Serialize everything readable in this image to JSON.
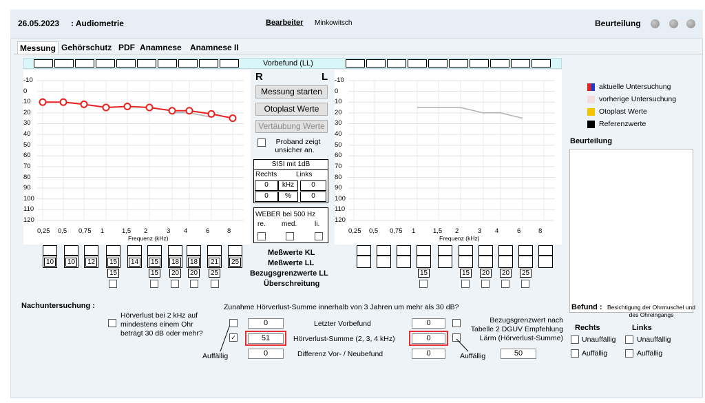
{
  "header": {
    "date": "26.05.2023",
    "title": ": Audiometrie",
    "bearbeiter_label": "Bearbeiter",
    "bearbeiter_value": "Minkowitsch",
    "beurteilung_label": "Beurteilung"
  },
  "tabs": [
    "Messung",
    "Gehörschutz",
    "PDF",
    "Anamnese",
    "Anamnese II"
  ],
  "vorbefund_label": "Vorbefund (LL)",
  "y_ticks": [
    "-10",
    "0",
    "10",
    "20",
    "30",
    "40",
    "50",
    "60",
    "70",
    "80",
    "90",
    "100",
    "110",
    "120"
  ],
  "x_ticks": [
    "0,25",
    "0,5",
    "0,75",
    "1",
    "1,5",
    "2",
    "3",
    "4",
    "6",
    "8"
  ],
  "x_axis_label": "Frequenz (kHz)",
  "right_label": "R",
  "left_label": "L",
  "buttons": {
    "start": "Messung starten",
    "otoplast": "Otoplast Werte",
    "vertaeubung": "Vertäubung Werte"
  },
  "proband": "Proband zeigt unsicher an.",
  "sisi": {
    "title": "SISI mit 1dB",
    "rechts": "Rechts",
    "links": "Links",
    "r1": "0",
    "unit1": "kHz",
    "l1": "0",
    "r2": "0",
    "unit2": "%",
    "l2": "0"
  },
  "weber": {
    "title": "WEBER bei 500 Hz",
    "re": "re.",
    "med": "med.",
    "li": "li."
  },
  "row_labels": {
    "kl": "Meßwerte KL",
    "ll": "Meßwerte LL",
    "bezug": "Bezugsgrenzwerte LL",
    "ueber": "Überschreitung"
  },
  "right_ll_values": [
    "10",
    "10",
    "12",
    "15",
    "14",
    "15",
    "18",
    "18",
    "21",
    "25"
  ],
  "right_bezug": [
    "15",
    "",
    "",
    "15",
    "20",
    "20",
    "25"
  ],
  "left_bezug": [
    "15",
    "",
    "15",
    "20",
    "20",
    "25"
  ],
  "chart_data": [
    {
      "type": "line",
      "title": "",
      "xlabel": "Frequenz (kHz)",
      "ylabel": "",
      "categories": [
        "0,25",
        "0,5",
        "0,75",
        "1",
        "1,5",
        "2",
        "3",
        "4",
        "6",
        "8"
      ],
      "ylim": [
        -10,
        120
      ],
      "y_inverted": true,
      "series": [
        {
          "values": [
            10,
            10,
            12,
            15,
            14,
            15,
            18,
            18,
            21,
            25
          ],
          "color": "#e8211e",
          "markers": "circle"
        },
        {
          "values": [
            null,
            null,
            null,
            null,
            null,
            null,
            20,
            20,
            24,
            null
          ],
          "color": "#b5b5b5"
        }
      ]
    },
    {
      "type": "line",
      "title": "",
      "xlabel": "Frequenz (kHz)",
      "ylabel": "",
      "categories": [
        "0,25",
        "0,5",
        "0,75",
        "1",
        "1,5",
        "2",
        "3",
        "4",
        "6",
        "8"
      ],
      "ylim": [
        -10,
        120
      ],
      "y_inverted": true,
      "series": [
        {
          "values": [
            null,
            null,
            null,
            15,
            15,
            15,
            20,
            20,
            25,
            null
          ],
          "color": "#b5b5b5"
        }
      ]
    }
  ],
  "legend": [
    {
      "label": "aktuelle Untersuchung",
      "color": "#1f3ccc"
    },
    {
      "label": "vorherige Untersuchung",
      "color": "#f3dede"
    },
    {
      "label": "Otoplast Werte",
      "color": "#f5c400"
    },
    {
      "label": "Referenzwerte",
      "color": "#000000"
    }
  ],
  "beurteilung_box_label": "Beurteilung",
  "nachuntersuchung": {
    "title": "Nachuntersuchung :",
    "q_hv": "Hörverlust bei 2 kHz auf mindestens einem Ohr beträgt 30 dB oder mehr?",
    "zunahme": "Zunahme Hörverlust-Summe innerhalb von 3 Jahren um mehr als 30 dB?",
    "letzter": "Letzter Vorbefund",
    "summe": "Hörverlust-Summe (2, 3, 4 kHz)",
    "differenz": "Differenz Vor- / Neubefund",
    "auffaellig": "Auffällig",
    "r_letzter": "0",
    "r_summe": "51",
    "r_diff": "0",
    "l_letzter": "0",
    "l_summe": "0",
    "l_diff": "0",
    "bezug_text": "Bezugsgrenzwert nach Tabelle 2 DGUV Empfehlung Lärm (Hörverlust-Summe)",
    "bezug_value": "50"
  },
  "befund": {
    "title": "Befund :",
    "subtitle": "Besichtigung der Ohrmuschel und des Ohreingangs",
    "rechts": "Rechts",
    "links": "Links",
    "unauff": "Unauffällig",
    "auff": "Auffällig"
  }
}
